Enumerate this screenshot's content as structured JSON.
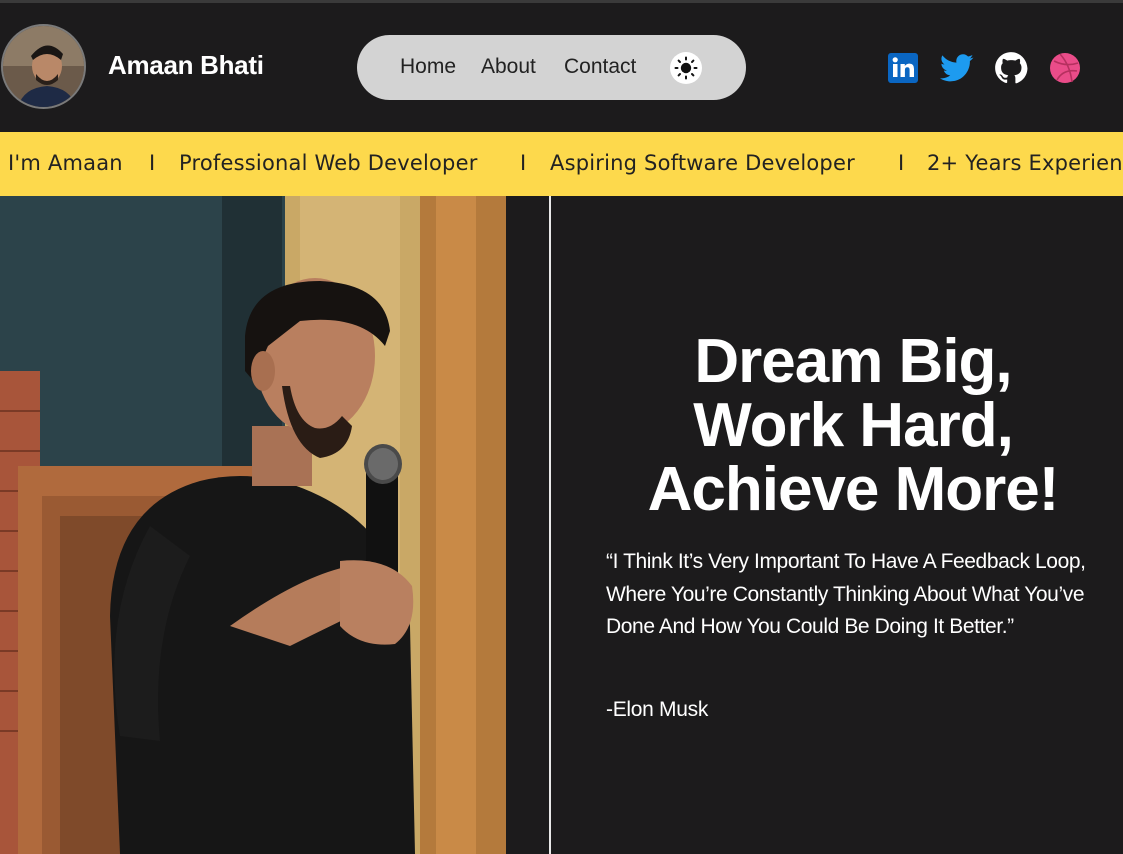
{
  "header": {
    "name": "Amaan Bhati",
    "avatar_icon": "avatar-photo",
    "nav": [
      {
        "label": "Home"
      },
      {
        "label": "About"
      },
      {
        "label": "Contact"
      }
    ],
    "theme_toggle_icon": "sun-icon",
    "social": [
      {
        "icon": "linkedin-icon",
        "color": "#0a66c2"
      },
      {
        "icon": "twitter-icon",
        "color": "#1d9bf0"
      },
      {
        "icon": "github-icon",
        "color": "#ffffff"
      },
      {
        "icon": "dribbble-icon",
        "color": "#ea4c89"
      }
    ]
  },
  "ticker": {
    "items": [
      "I'm Amaan",
      "Professional Web Developer",
      "Aspiring Software Developer",
      "2+ Years Experien"
    ],
    "separator": "I",
    "background": "#fdd94c"
  },
  "hero": {
    "headline_lines": [
      "Dream Big,",
      "Work Hard,",
      "Achieve More!"
    ],
    "quote": "“I Think It’s Very Important To Have A Feedback Loop, Where You’re Constantly Thinking About What You’ve Done And How You Could Be Doing It Better.”",
    "author": "-Elon Musk"
  },
  "colors": {
    "background": "#1c1b1c",
    "nav_pill": "#d3d3d3",
    "accent_yellow": "#fdd94c"
  }
}
